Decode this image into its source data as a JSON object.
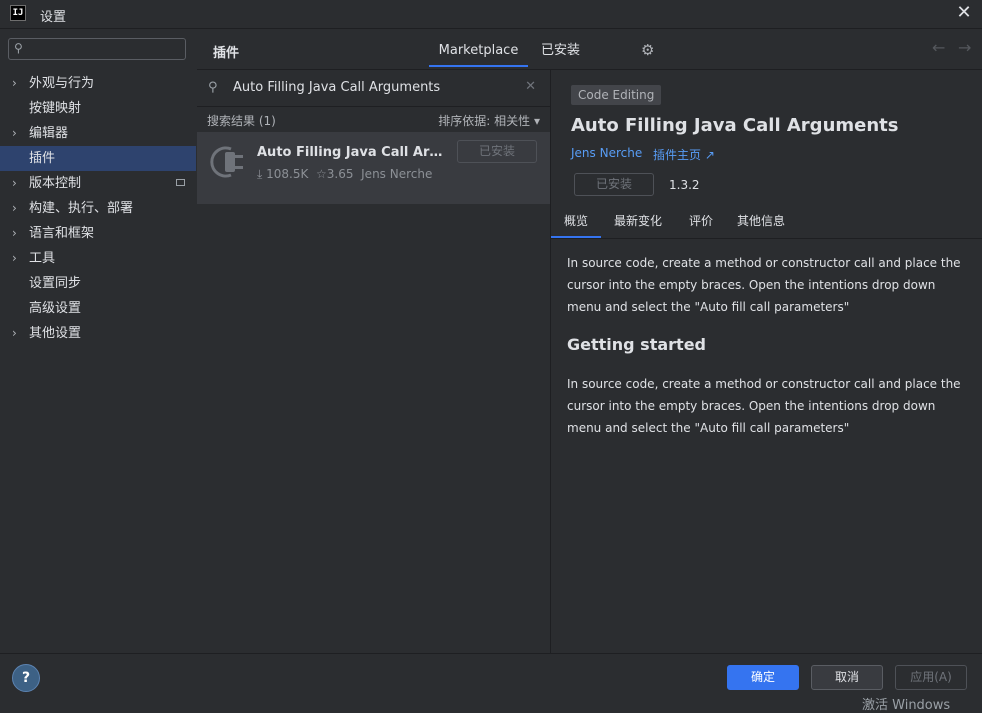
{
  "window": {
    "title": "设置",
    "logo_text": "IJ"
  },
  "sidebar": {
    "search_placeholder": "",
    "items": [
      {
        "label": "外观与行为",
        "arrow": true
      },
      {
        "label": "按键映射",
        "arrow": false
      },
      {
        "label": "编辑器",
        "arrow": true
      },
      {
        "label": "插件",
        "arrow": false,
        "selected": true
      },
      {
        "label": "版本控制",
        "arrow": true
      },
      {
        "label": "构建、执行、部署",
        "arrow": true
      },
      {
        "label": "语言和框架",
        "arrow": true
      },
      {
        "label": "工具",
        "arrow": true
      },
      {
        "label": "设置同步",
        "arrow": false
      },
      {
        "label": "高级设置",
        "arrow": false
      },
      {
        "label": "其他设置",
        "arrow": true
      }
    ]
  },
  "header": {
    "title": "插件",
    "tabs": [
      "Marketplace",
      "已安装"
    ]
  },
  "list": {
    "search_value": "Auto Filling Java Call Arguments",
    "results_label": "搜索结果 (1)",
    "sort_label": "排序依据: 相关性 ▾",
    "plugin": {
      "name": "Auto Filling Java Call Argum...",
      "downloads": "108.5K",
      "rating": "3.65",
      "author": "Jens Nerche",
      "button": "已安装"
    }
  },
  "detail": {
    "tag": "Code Editing",
    "title": "Auto Filling Java Call Arguments",
    "author": "Jens Nerche",
    "homepage": "插件主页",
    "button": "已安装",
    "version": "1.3.2",
    "tabs": [
      "概览",
      "最新变化",
      "评价",
      "其他信息"
    ],
    "paragraph1": "In source code, create a method or constructor call and place the cursor into the empty braces. Open the intentions drop down menu and select the \"Auto fill call parameters\"",
    "heading": "Getting started",
    "paragraph2": "In source code, create a method or constructor call and place the cursor into the empty braces. Open the intentions drop down menu and select the \"Auto fill call parameters\""
  },
  "footer": {
    "help": "?",
    "ok": "确定",
    "cancel": "取消",
    "apply": "应用(A)",
    "watermark": "激活 Windows"
  },
  "colors": {
    "accent": "#3574f0",
    "link": "#589df6",
    "selection": "#2e436e"
  }
}
